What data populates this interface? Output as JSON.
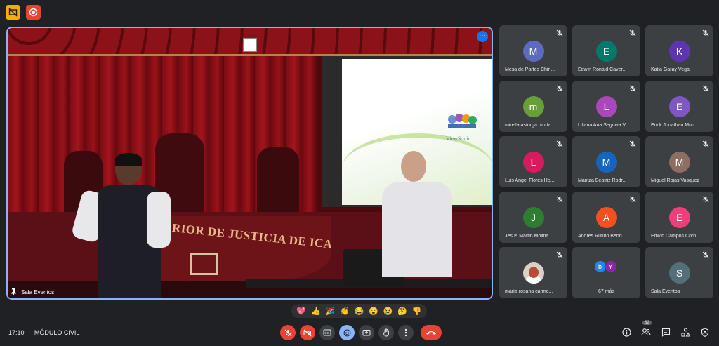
{
  "meeting": {
    "time": "17:10",
    "separator": "|",
    "title": "MÓDULO CIVIL"
  },
  "stage": {
    "label": "Sala Eventos",
    "banner_text": "UPERIOR DE JUSTICIA DE ICA",
    "screen_logo_text": "ViewSonic"
  },
  "participants": [
    {
      "initial": "M",
      "name": "Mesa de Partes Chin...",
      "color": "#5c6bc0"
    },
    {
      "initial": "E",
      "name": "Edwin Ronald Caver...",
      "color": "#00796b"
    },
    {
      "initial": "K",
      "name": "Katia Garay Vega",
      "color": "#5e35b1"
    },
    {
      "initial": "m",
      "name": "mirella astorga motta",
      "color": "#689f38"
    },
    {
      "initial": "L",
      "name": "Liliana Ana Segovia V...",
      "color": "#ab47bc"
    },
    {
      "initial": "E",
      "name": "Erick Jonathan Mun...",
      "color": "#7e57c2"
    },
    {
      "initial": "L",
      "name": "Luis Angel Flores He...",
      "color": "#d81b60"
    },
    {
      "initial": "M",
      "name": "Maritza Beatriz Rodr...",
      "color": "#1565c0"
    },
    {
      "initial": "M",
      "name": "Miguel Rojas Vasquez",
      "color": "#8d6e63"
    },
    {
      "initial": "J",
      "name": "Jesus Martin Molina ...",
      "color": "#2e7d32"
    },
    {
      "initial": "A",
      "name": "Andres Rufino Bend...",
      "color": "#f4511e"
    },
    {
      "initial": "E",
      "name": "Edwin Campos Corn...",
      "color": "#ec407a"
    },
    {
      "initial": "",
      "name": "maría rosana carme...",
      "color": "#d9d0c8"
    },
    {
      "initial": "",
      "name": "67 más",
      "color": ""
    },
    {
      "initial": "S",
      "name": "Sala Eventos",
      "color": "#546e7a"
    }
  ],
  "more_tile": {
    "avatars": [
      {
        "initial": "b",
        "color": "#1e88e5"
      },
      {
        "initial": "Y",
        "color": "#8e24aa"
      }
    ]
  },
  "reactions": [
    "💖",
    "👍",
    "🎉",
    "👏",
    "😂",
    "😮",
    "😢",
    "🤔",
    "👎"
  ],
  "toolbar": {
    "participant_count": "82"
  },
  "colors": {
    "background": "#202124",
    "tile": "#3c4043",
    "accent": "#8ab4f8",
    "danger": "#ea4335"
  }
}
